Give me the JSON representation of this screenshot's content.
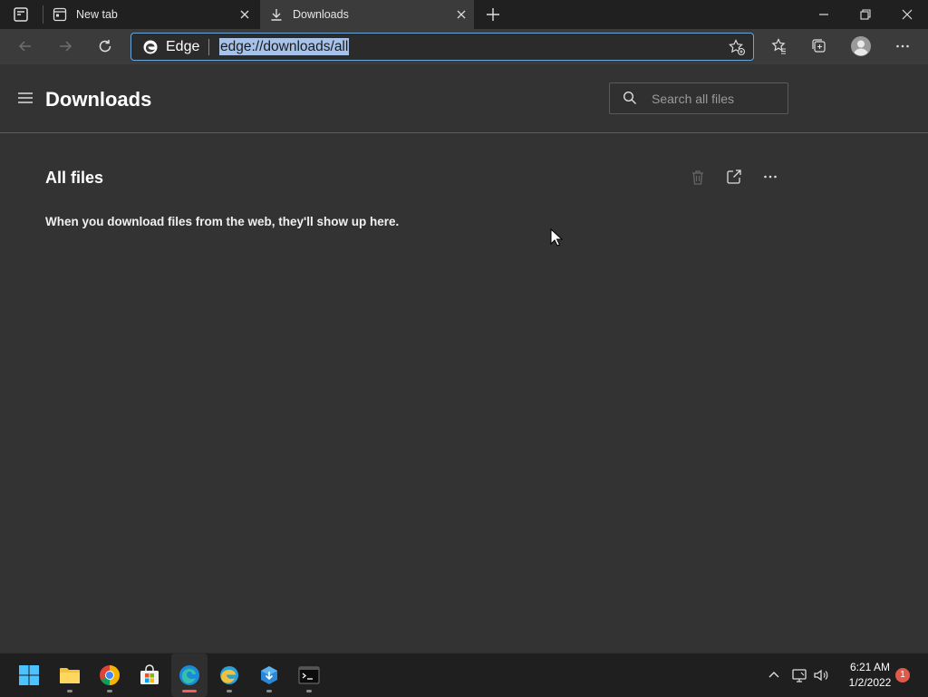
{
  "browser": {
    "tabs": [
      {
        "label": "New tab",
        "icon": "newtab-icon",
        "active": false
      },
      {
        "label": "Downloads",
        "icon": "download-icon",
        "active": true
      }
    ],
    "address_bar": {
      "brand_label": "Edge",
      "url": "edge://downloads/all"
    }
  },
  "downloads_page": {
    "title": "Downloads",
    "search_placeholder": "Search all files",
    "section_title": "All files",
    "empty_message": "When you download files from the web, they'll show up here."
  },
  "taskbar": {
    "apps": [
      {
        "name": "windows-start",
        "icon": "windows-logo-icon",
        "active": false
      },
      {
        "name": "file-explorer",
        "icon": "folder-icon",
        "active": false
      },
      {
        "name": "chrome",
        "icon": "chrome-icon",
        "active": false
      },
      {
        "name": "microsoft-store",
        "icon": "store-icon",
        "active": false
      },
      {
        "name": "edge",
        "icon": "edge-icon",
        "active": true
      },
      {
        "name": "edge-beta",
        "icon": "edge-beta-icon",
        "active": false
      },
      {
        "name": "app-installer",
        "icon": "app-installer-icon",
        "active": false
      },
      {
        "name": "terminal",
        "icon": "terminal-icon",
        "active": false
      }
    ],
    "clock": {
      "time": "6:21 AM",
      "date": "1/2/2022"
    },
    "notification_count": "1"
  },
  "colors": {
    "page_bg": "#333333",
    "tabstrip_bg": "#202020",
    "toolbar_bg": "#3b3b3b",
    "address_focus": "#6aa5d8",
    "url_selection": "#a7c2e8",
    "badge": "#e05a4b"
  }
}
